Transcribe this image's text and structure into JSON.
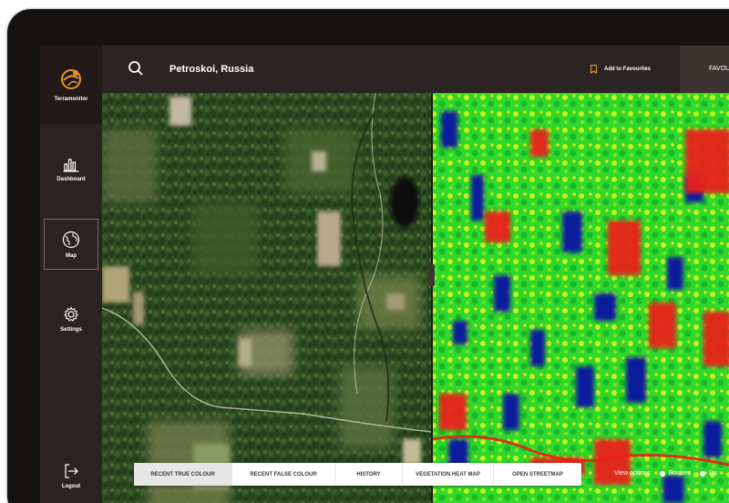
{
  "app": {
    "name": "Terramonitor"
  },
  "sidebar": {
    "items": [
      {
        "label": "Dashboard",
        "icon": "bar-chart-icon"
      },
      {
        "label": "Map",
        "icon": "globe-icon",
        "active": true
      },
      {
        "label": "Settings",
        "icon": "gear-icon"
      },
      {
        "label": "Logout",
        "icon": "logout-icon"
      }
    ]
  },
  "header": {
    "location": "Petroskoi, Russia",
    "favourite_label": "Add to Favourites",
    "favourites_tab": "FAVOURI"
  },
  "map_tabs": [
    {
      "label": "RECENT TRUE COLOUR",
      "active": true
    },
    {
      "label": "RECENT FALSE COLOUR"
    },
    {
      "label": "HISTORY"
    },
    {
      "label": "VEGETATION HEAT MAP"
    },
    {
      "label": "OPEN STREETMAP"
    }
  ],
  "view_options": {
    "label": "View options",
    "options": [
      "Borders",
      "Da"
    ]
  },
  "colors": {
    "accent": "#e8962b",
    "sidebar": "#2b2321",
    "heat_low": "#0a1f9c",
    "heat_mid": "#2fd82a",
    "heat_high": "#e9201a"
  }
}
